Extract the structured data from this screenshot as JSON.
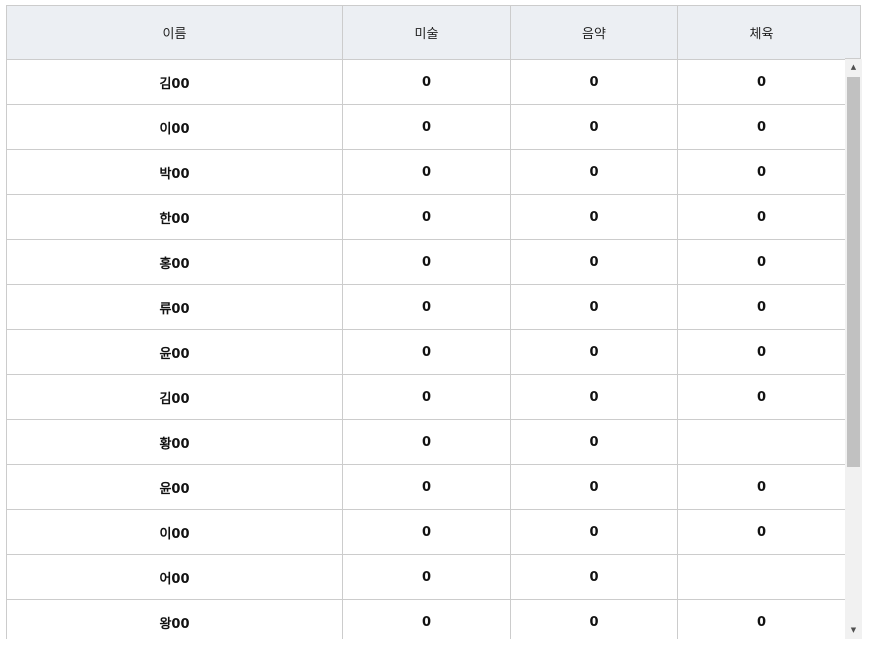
{
  "table": {
    "columns": [
      "이름",
      "미술",
      "음약",
      "체육"
    ],
    "rows": [
      [
        "김00",
        "0",
        "0",
        "0"
      ],
      [
        "이00",
        "0",
        "0",
        "0"
      ],
      [
        "박00",
        "0",
        "0",
        "0"
      ],
      [
        "한00",
        "0",
        "0",
        "0"
      ],
      [
        "홍00",
        "0",
        "0",
        "0"
      ],
      [
        "류00",
        "0",
        "0",
        "0"
      ],
      [
        "윤00",
        "0",
        "0",
        "0"
      ],
      [
        "김00",
        "0",
        "0",
        "0"
      ],
      [
        "황00",
        "0",
        "0",
        ""
      ],
      [
        "윤00",
        "0",
        "0",
        "0"
      ],
      [
        "이00",
        "0",
        "0",
        "0"
      ],
      [
        "어00",
        "0",
        "0",
        ""
      ],
      [
        "왕00",
        "0",
        "0",
        "0"
      ]
    ]
  },
  "scrollbar": {
    "up_icon": "triangle-up-icon",
    "down_icon": "triangle-down-icon"
  }
}
